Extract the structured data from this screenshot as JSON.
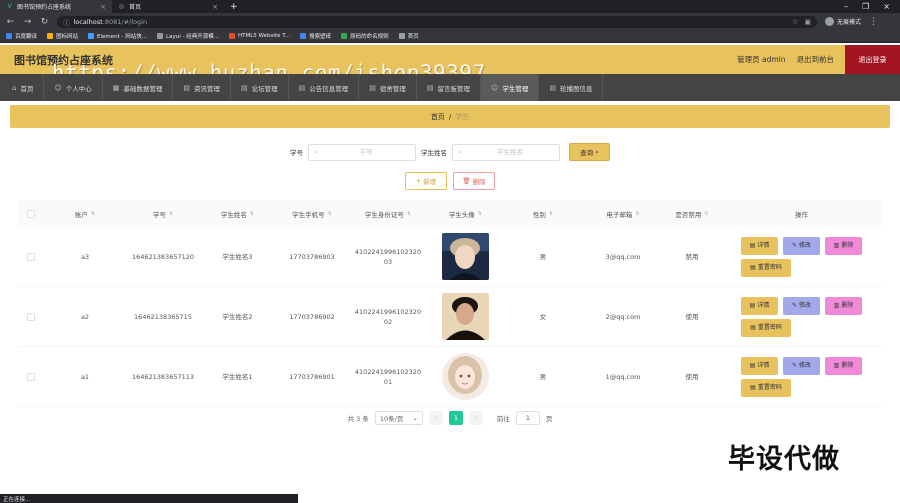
{
  "browser": {
    "tabs": [
      {
        "label": "图书馆预约占座系统",
        "active": true
      },
      {
        "label": "首页",
        "active": false
      }
    ],
    "url_host": "localhost",
    "url_path": ":8081/#/login",
    "profile": "无痕模式",
    "bookmarks": [
      "百度翻译",
      "图标网站",
      "Element - 网站快...",
      "Layui - 经典开源模...",
      "HTML5 Website T...",
      "搜索壁纸",
      "原码的命名规则",
      "首页"
    ]
  },
  "header": {
    "title": "图书馆预约占座系统",
    "admin": "管理员 admin",
    "back_frontend": "退出到前台",
    "logout": "退出登录"
  },
  "watermark": "https://www.huzhan.com/ishop39397",
  "nav": [
    {
      "label": "首页",
      "icon": "⌂",
      "active": false
    },
    {
      "label": "个人中心",
      "icon": "☺",
      "active": false
    },
    {
      "label": "基础数据管理",
      "icon": "▦",
      "active": false
    },
    {
      "label": "资讯管理",
      "icon": "▤",
      "active": false
    },
    {
      "label": "论坛管理",
      "icon": "▤",
      "active": false
    },
    {
      "label": "公告信息管理",
      "icon": "▤",
      "active": false
    },
    {
      "label": "宿舍管理",
      "icon": "▤",
      "active": false
    },
    {
      "label": "留言板管理",
      "icon": "▤",
      "active": false
    },
    {
      "label": "学生管理",
      "icon": "☺",
      "active": true
    },
    {
      "label": "轮播图信息",
      "icon": "▤",
      "active": false
    }
  ],
  "breadcrumb": {
    "home": "首页",
    "sep": "/",
    "current": "学生"
  },
  "search": {
    "id_label": "学号",
    "id_placeholder": "学号",
    "name_label": "学生姓名",
    "name_placeholder": "学生姓名",
    "query_button": "查询"
  },
  "actions": {
    "add": "新增",
    "delete": "删除"
  },
  "table": {
    "headers": [
      "账户",
      "学号",
      "学生姓名",
      "学生手机号",
      "学生身份证号",
      "学生头像",
      "性别",
      "电子邮箱",
      "是否禁用",
      "操作"
    ],
    "rows": [
      {
        "account": "a3",
        "student_id": "164621383657120",
        "name": "学生姓名3",
        "phone": "17703786903",
        "id_card_1": "4102241996102320",
        "id_card_2": "03",
        "gender": "男",
        "email": "3@qq.com",
        "status": "禁用",
        "avatar": "young man light hair"
      },
      {
        "account": "a2",
        "student_id": "16462138365715",
        "name": "学生姓名2",
        "phone": "17703786902",
        "id_card_1": "4102241996102320",
        "id_card_2": "02",
        "gender": "女",
        "email": "2@qq.com",
        "status": "使用",
        "avatar": "young man dark jacket"
      },
      {
        "account": "a1",
        "student_id": "164621383657113",
        "name": "学生姓名1",
        "phone": "17703786901",
        "id_card_1": "4102241996102320",
        "id_card_2": "01",
        "gender": "男",
        "email": "1@qq.com",
        "status": "使用",
        "avatar": "illustrated girl"
      }
    ],
    "ops": {
      "detail": "详情",
      "edit": "修改",
      "delete": "删除",
      "reset": "重置密码"
    }
  },
  "pagination": {
    "total": "共 3 条",
    "page_size": "10条/页",
    "current": "1",
    "goto_label": "前往",
    "goto_value": "1",
    "page_suffix": "页"
  },
  "brand_mark": "毕设代做",
  "status_text": "正在连接...",
  "colors": {
    "primary": "#e8c25c",
    "nav_bg": "#444444",
    "logout": "#a31621",
    "edit": "#a3a8e8",
    "delete": "#f08ad8",
    "pager_active": "#20c997"
  }
}
